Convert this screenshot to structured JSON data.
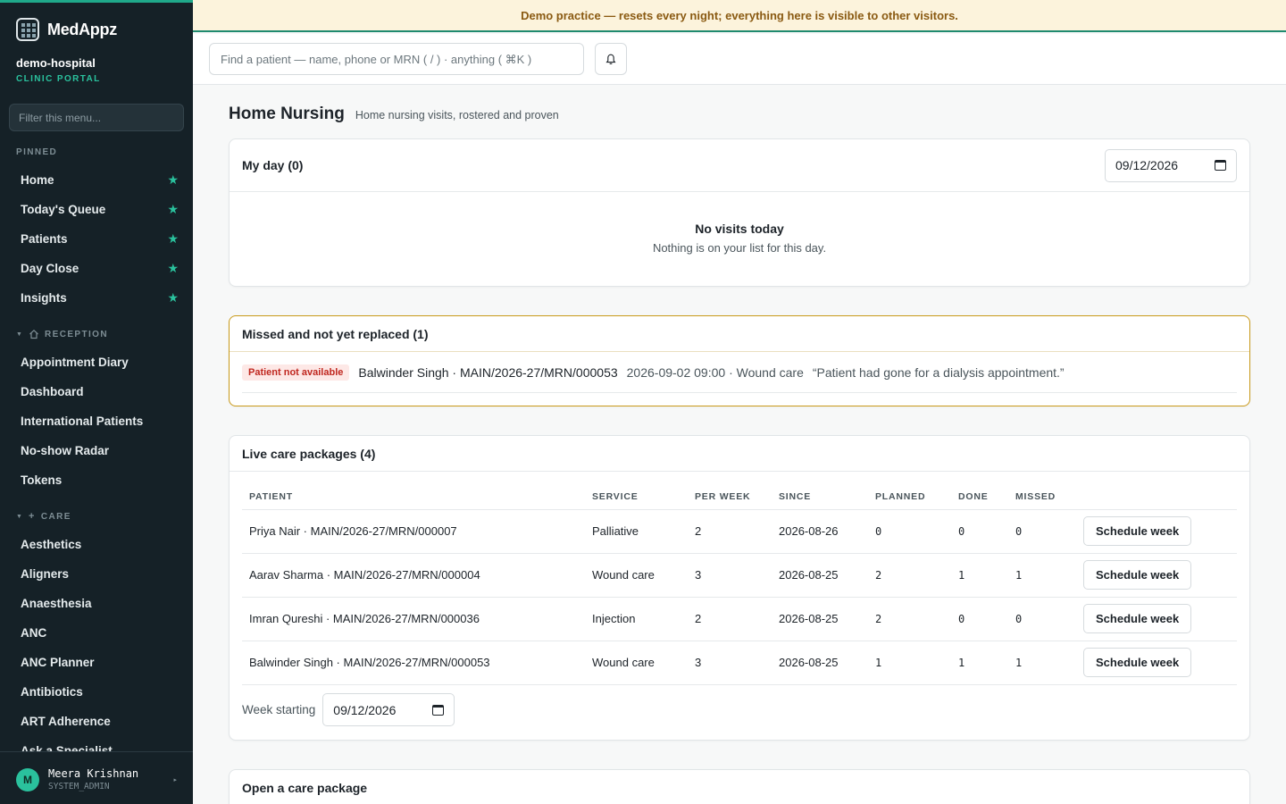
{
  "brand": {
    "name": "MedAppz"
  },
  "org": {
    "name": "demo-hospital",
    "subtitle": "CLINIC PORTAL"
  },
  "sidebar": {
    "filter_placeholder": "Filter this menu...",
    "pinned_label": "PINNED",
    "pinned": [
      {
        "label": "Home",
        "icon": "star-icon"
      },
      {
        "label": "Today's Queue",
        "icon": "star-icon"
      },
      {
        "label": "Patients",
        "icon": "star-icon"
      },
      {
        "label": "Day Close",
        "icon": "star-icon"
      },
      {
        "label": "Insights",
        "icon": "star-icon"
      }
    ],
    "star_glyph": "★",
    "reception_label": "RECEPTION",
    "reception": [
      "Appointment Diary",
      "Dashboard",
      "International Patients",
      "No-show Radar",
      "Tokens"
    ],
    "care_label": "CARE",
    "care": [
      "Aesthetics",
      "Aligners",
      "Anaesthesia",
      "ANC",
      "ANC Planner",
      "Antibiotics",
      "ART Adherence",
      "Ask a Specialist"
    ],
    "user": {
      "initial": "M",
      "name": "Meera Krishnan",
      "role": "SYSTEM_ADMIN"
    }
  },
  "banner": {
    "text": "Demo practice — resets every night; everything here is visible to other visitors."
  },
  "topbar": {
    "search_placeholder": "Find a patient — name, phone or MRN ( / ) · anything ( ⌘K )"
  },
  "page": {
    "title": "Home Nursing",
    "subtitle": "Home nursing visits, rostered and proven"
  },
  "my_day": {
    "title": "My day (0)",
    "date": "09/12/2026",
    "empty_title": "No visits today",
    "empty_sub": "Nothing is on your list for this day."
  },
  "missed": {
    "title": "Missed and not yet replaced (1)",
    "rows": [
      {
        "badge": "Patient not available",
        "patient": "Balwinder Singh · MAIN/2026-27/MRN/000053",
        "when": "2026-09-02 09:00 · Wound care",
        "note": "“Patient had gone for a dialysis appointment.”"
      }
    ]
  },
  "packages": {
    "title": "Live care packages (4)",
    "columns": [
      "PATIENT",
      "SERVICE",
      "PER WEEK",
      "SINCE",
      "PLANNED",
      "DONE",
      "MISSED"
    ],
    "rows": [
      {
        "patient": "Priya Nair · MAIN/2026-27/MRN/000007",
        "service": "Palliative",
        "per_week": "2",
        "since": "2026-08-26",
        "planned": "0",
        "done": "0",
        "missed": "0",
        "action": "Schedule week"
      },
      {
        "patient": "Aarav Sharma · MAIN/2026-27/MRN/000004",
        "service": "Wound care",
        "per_week": "3",
        "since": "2026-08-25",
        "planned": "2",
        "done": "1",
        "missed": "1",
        "action": "Schedule week"
      },
      {
        "patient": "Imran Qureshi · MAIN/2026-27/MRN/000036",
        "service": "Injection",
        "per_week": "2",
        "since": "2026-08-25",
        "planned": "2",
        "done": "0",
        "missed": "0",
        "action": "Schedule week"
      },
      {
        "patient": "Balwinder Singh · MAIN/2026-27/MRN/000053",
        "service": "Wound care",
        "per_week": "3",
        "since": "2026-08-25",
        "planned": "1",
        "done": "1",
        "missed": "1",
        "action": "Schedule week"
      }
    ],
    "week_label": "Week starting",
    "week_date": "09/12/2026"
  },
  "open_package": {
    "title": "Open a care package"
  },
  "colors": {
    "accent": "#2ac19d",
    "sidebar_bg": "#152127",
    "banner_bg": "#fcf3dc",
    "warning_border": "#c99a1a",
    "danger": "#c0271f"
  }
}
